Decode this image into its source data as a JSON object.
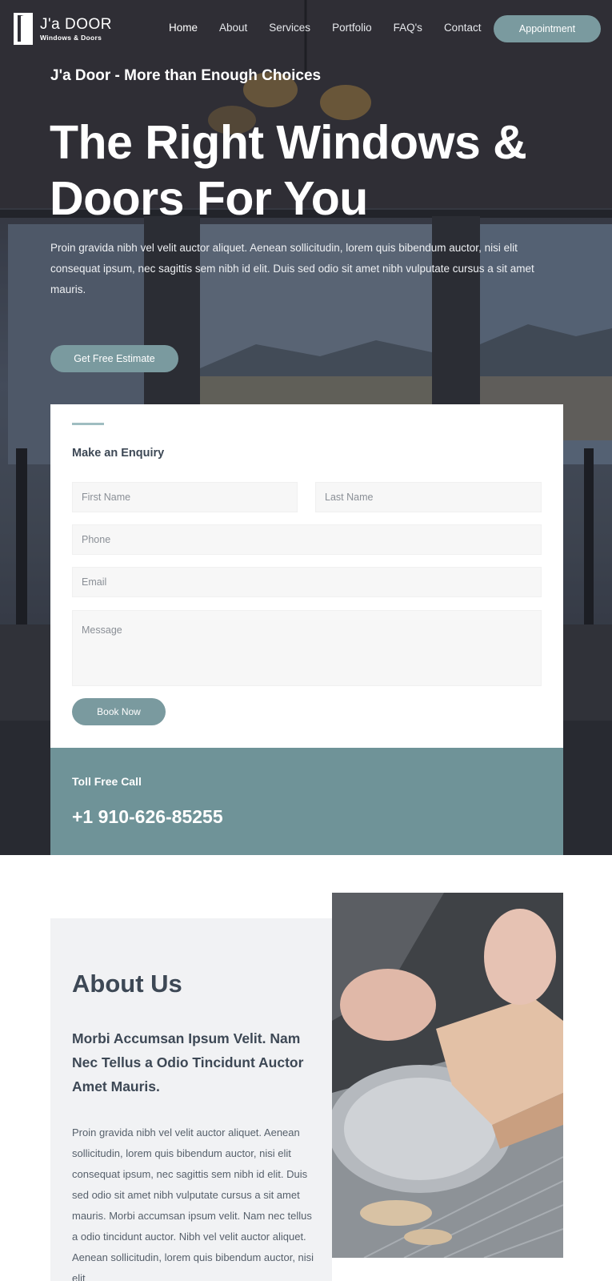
{
  "brand": {
    "name": "J'a DOOR",
    "sub": "Windows & Doors"
  },
  "nav": {
    "items": [
      {
        "label": "Home"
      },
      {
        "label": "About"
      },
      {
        "label": "Services"
      },
      {
        "label": "Portfolio"
      },
      {
        "label": "FAQ's"
      },
      {
        "label": "Contact"
      }
    ],
    "active": "Home",
    "cta_label": "Appointment"
  },
  "hero": {
    "tagline": "J'a Door - More than Enough Choices",
    "title": "The Right Windows & Doors For You",
    "description": "Proin gravida nibh vel velit auctor aliquet. Aenean sollicitudin, lorem quis bibendum auctor, nisi elit consequat ipsum, nec sagittis sem nibh id elit. Duis sed odio sit amet nibh vulputate cursus a sit amet mauris.",
    "cta_label": "Get Free Estimate"
  },
  "enquiry": {
    "title": "Make an Enquiry",
    "fields": {
      "first_name": "First Name",
      "last_name": "Last Name",
      "phone": "Phone",
      "email": "Email",
      "message": "Message"
    },
    "submit_label": "Book Now"
  },
  "toll_free": {
    "label": "Toll Free Call",
    "number": "+1 910-626-85255"
  },
  "about": {
    "title": "About Us",
    "subtitle": "Morbi Accumsan Ipsum Velit. Nam Nec Tellus a Odio Tincidunt Auctor Amet Mauris.",
    "body": "Proin gravida nibh vel velit auctor aliquet. Aenean sollicitudin, lorem quis bibendum auctor, nisi elit consequat ipsum, nec sagittis sem nibh id elit. Duis sed odio sit amet nibh vulputate cursus a sit amet mauris. Morbi accumsan ipsum velit. Nam nec tellus a odio tincidunt auctor. Nibh vel velit auctor aliquet. Aenean sollicitudin, lorem quis bibendum auctor, nisi elit"
  },
  "colors": {
    "accent": "#7a9a9f",
    "toll_bg": "#6f9398",
    "heading": "#3d4855",
    "panel_bg": "#f1f2f4"
  }
}
